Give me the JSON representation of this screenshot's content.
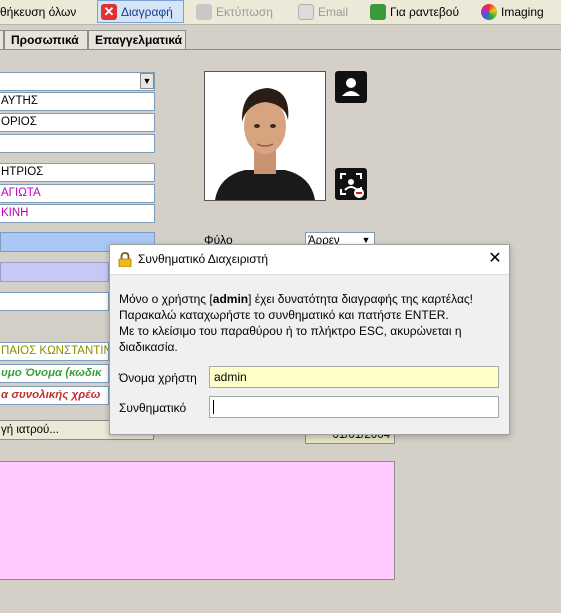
{
  "toolbar": {
    "save_all": "θήκευση όλων",
    "delete": "Διαγραφή",
    "print": "Εκτύπωση",
    "email": "Email",
    "appointment": "Για ραντεβού",
    "imaging": "Imaging"
  },
  "tabs": [
    "Προσωπικά",
    "Επαγγελματικά"
  ],
  "form": {
    "surname": "ΑΥΤΗΣ",
    "name": "ΟΡΙΟΣ",
    "father": "ΗΤΡΙΟΣ",
    "mother": "ΑΓΙΩΤΑ",
    "spouse": "ΚΙΝΗ",
    "gender_label": "Φύλο",
    "gender_value": "Άρρεν",
    "doctor": "ΠΑΙΟΣ ΚΩΝΣΤΑΝΤΙΝ",
    "nickname": "υμο Όνομα (κωδικ",
    "charge": "α συνολικής χρέω",
    "doctor_button": "γή ιατρού...",
    "date": "01/01/2004"
  },
  "dialog": {
    "title": "Συνθηματικό Διαχειριστή",
    "message_line1_pre": "Μόνο ο χρήστης [",
    "message_user": "admin",
    "message_line1_post": "] έχει δυνατότητα διαγραφής της καρτέλας!",
    "message_line2": "Παρακαλώ καταχωρήστε το συνθηματικό και πατήστε ENTER.",
    "message_line3": "Με το κλείσιμο του παραθύρου ή το πλήκτρο ESC, ακυρώνεται η",
    "message_line4": "διαδικασία.",
    "username_label": "Όνομα χρήστη",
    "username_value": "admin",
    "password_label": "Συνθηματικό",
    "password_value": ""
  },
  "colors": {
    "pink_area": "#ffc8ff",
    "blue_bar": "#a9c8f5",
    "lilac_bar": "#c8c8f5",
    "doctor_text": "#8c8c00",
    "nickname_text": "#3aa03a",
    "charge_text": "#c03030",
    "magenta_text": "#c000c0",
    "username_bg": "#ffffc8"
  }
}
